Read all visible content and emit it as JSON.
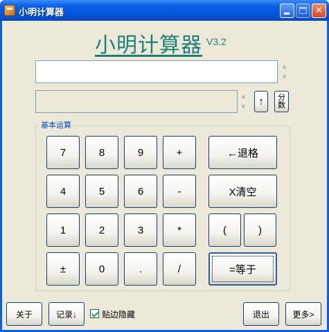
{
  "window": {
    "title": "小明计算器"
  },
  "header": {
    "app_name": "小明计算器",
    "version": "V3.2"
  },
  "display": {
    "expression_value": "",
    "result_value": ""
  },
  "tools": {
    "up_arrow": "↑",
    "fraction_label": "分数"
  },
  "group": {
    "label": "基本运算"
  },
  "keypad": {
    "row1": [
      "7",
      "8",
      "9",
      "+"
    ],
    "row2": [
      "4",
      "5",
      "6",
      "-"
    ],
    "row3": [
      "1",
      "2",
      "3",
      "*"
    ],
    "row4": [
      "±",
      "0",
      ".",
      "/"
    ]
  },
  "actions": {
    "backspace": "←退格",
    "clear": "X清空",
    "lparen": "(",
    "rparen": ")",
    "equals": "=等于"
  },
  "footer": {
    "about": "关于",
    "record": "记录↓",
    "stick_hide_label": "贴边隐藏",
    "stick_hide_checked": true,
    "exit": "退出",
    "more": "更多>"
  }
}
